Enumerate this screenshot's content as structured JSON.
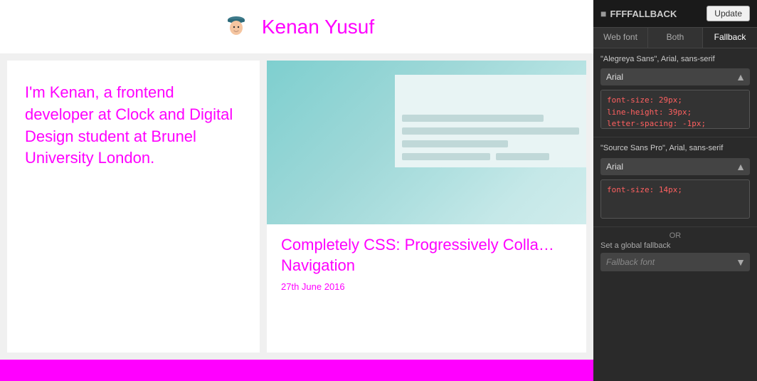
{
  "site": {
    "title": "Kenan Yusuf"
  },
  "intro": {
    "text": "I'm Kenan, a frontend developer at Clock and Digital Design student at Brunel University London."
  },
  "blog": {
    "title": "Completely CSS: Progressively Colla… Navigation",
    "date": "27th June 2016"
  },
  "panel": {
    "title": "FFFFALLBACK",
    "update_label": "Update",
    "tabs": [
      {
        "label": "Web font",
        "active": false
      },
      {
        "label": "Both",
        "active": false
      },
      {
        "label": "Fallback",
        "active": true
      }
    ],
    "font_entries": [
      {
        "family": "\"Alegreya Sans\", Arial, sans-serif",
        "fallback": "Arial",
        "css": "font-size: 29px;\nline-height: 39px;\nletter-spacing: -1px;"
      },
      {
        "family": "\"Source Sans Pro\", Arial, sans-serif",
        "fallback": "Arial",
        "css": "font-size: 14px;"
      }
    ],
    "or_text": "OR",
    "global_fallback_label": "Set a global fallback",
    "fallback_placeholder": "Fallback font"
  }
}
